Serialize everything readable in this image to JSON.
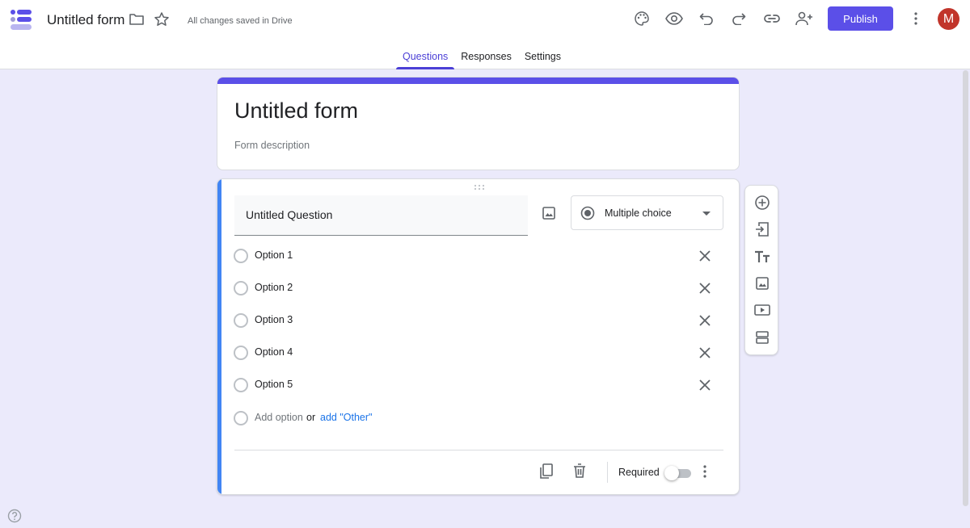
{
  "header": {
    "title": "Untitled form",
    "saved_status": "All changes saved in Drive",
    "publish_label": "Publish",
    "avatar_initial": "M",
    "icons": [
      "palette-icon",
      "preview-eye-icon",
      "undo-icon",
      "redo-icon",
      "link-icon",
      "add-collaborator-icon",
      "more-vert-icon"
    ]
  },
  "tabs": [
    {
      "label": "Questions",
      "active": true
    },
    {
      "label": "Responses",
      "active": false
    },
    {
      "label": "Settings",
      "active": false
    }
  ],
  "form": {
    "title": "Untitled form",
    "description_placeholder": "Form description"
  },
  "question": {
    "title": "Untitled Question",
    "type": "Multiple choice",
    "options": [
      "Option 1",
      "Option 2",
      "Option 3",
      "Option 4",
      "Option 5"
    ],
    "add_option_label": "Add option",
    "or_label": "or",
    "add_other_label": "add \"Other\"",
    "required_label": "Required",
    "required": false
  },
  "side_toolbar": {
    "icons": [
      "add-question-icon",
      "import-questions-icon",
      "add-title-icon",
      "add-image-icon",
      "add-video-icon",
      "add-section-icon"
    ]
  },
  "colors": {
    "accent": "#5b4fe8",
    "question_stripe": "#4285f4",
    "background": "#ebeafb",
    "avatar": "#c1352b",
    "link": "#1a73e8"
  }
}
